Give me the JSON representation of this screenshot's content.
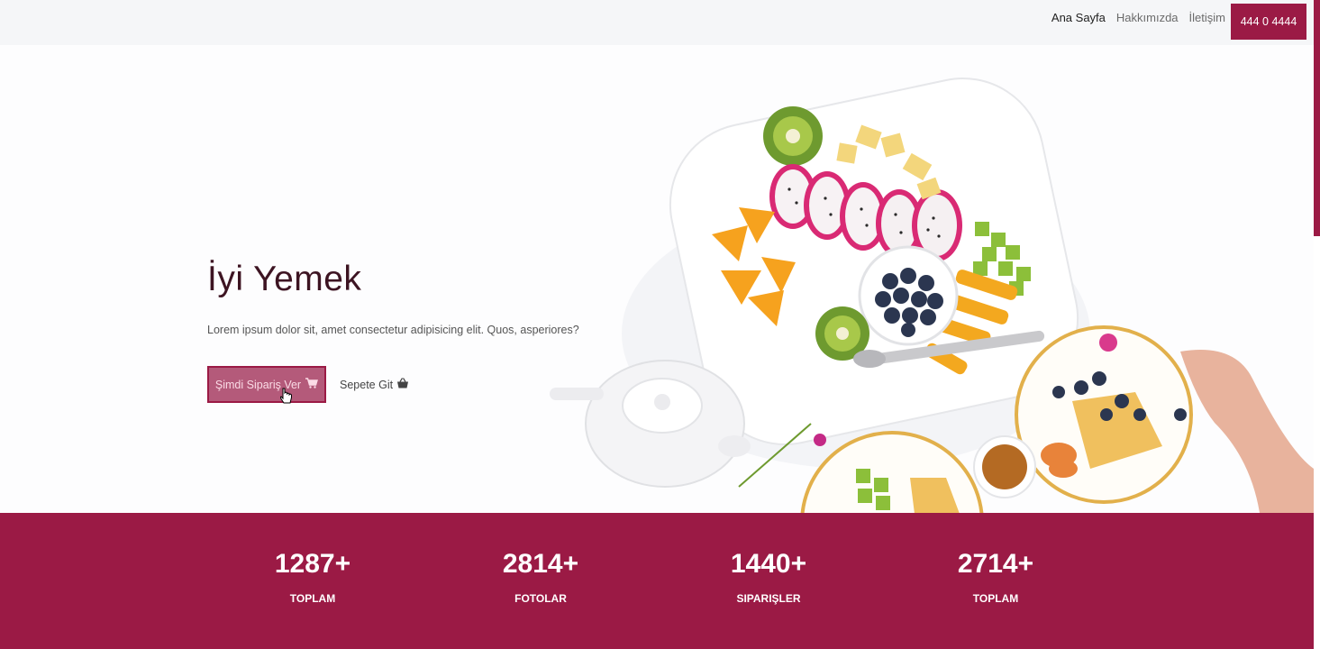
{
  "nav": {
    "links": [
      {
        "label": "Ana Sayfa"
      },
      {
        "label": "Hakkımızda"
      },
      {
        "label": "İletişim"
      }
    ],
    "phone": "444 0 4444"
  },
  "hero": {
    "title": "İyi Yemek",
    "description": "Lorem ipsum dolor sit, amet consectetur adipisicing elit. Quos, asperiores?",
    "order_button": "Şimdi Sipariş Ver",
    "cart_link": "Sepete Git"
  },
  "stats": [
    {
      "value": "1287+",
      "label": "TOPLAM"
    },
    {
      "value": "2814+",
      "label": "FOTOLAR"
    },
    {
      "value": "1440+",
      "label": "SIPARIŞLER"
    },
    {
      "value": "2714+",
      "label": "TOPLAM"
    }
  ],
  "colors": {
    "accent": "#9b1a45",
    "title": "#3d1422"
  },
  "icons": {
    "cart": "shopping-cart-icon",
    "basket": "basket-icon"
  }
}
